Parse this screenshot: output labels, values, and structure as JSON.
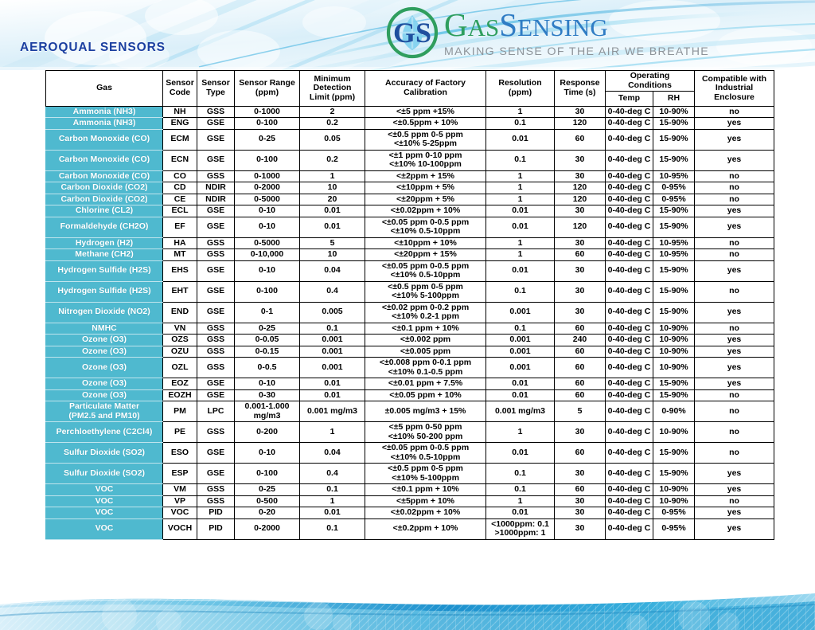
{
  "header": {
    "left_title": "AEROQUAL SENSORS",
    "logo": {
      "mark_name": "gs-monogram-logo",
      "word_1": "G",
      "word_2": "AS",
      "word_3": "S",
      "word_4": "ENSING",
      "tagline": "MAKING SENSE OF THE AIR WE BREATHE",
      "green": "#2f9e5e",
      "blue": "#2f7cc4",
      "tagline_color": "#8d9399"
    }
  },
  "colors": {
    "header_navy": "#1d3763",
    "gas_teal": "#4fb9cf",
    "title_blue": "#1b3fa0",
    "banner_blue": "#27a6d9"
  },
  "table": {
    "columns": [
      "Gas",
      "Sensor Code",
      "Sensor Type",
      "Sensor Range (ppm)",
      "Minimum Detection Limit (ppm)",
      "Accuracy of Factory Calibration",
      "Resolution (ppm)",
      "Response Time (s)",
      "Operating Conditions",
      "Compatible with Industrial Enclosure"
    ],
    "headers": {
      "gas": "Gas",
      "sensor_code_l1": "Sensor",
      "sensor_code_l2": "Code",
      "sensor_type_l1": "Sensor",
      "sensor_type_l2": "Type",
      "sensor_range_l1": "Sensor Range",
      "sensor_range_l2": "(ppm)",
      "min_det_l1": "Minimum",
      "min_det_l2": "Detection",
      "min_det_l3": "Limit (ppm)",
      "accuracy_l1": "Accuracy of Factory",
      "accuracy_l2": "Calibration",
      "resolution_l1": "Resolution",
      "resolution_l2": "(ppm)",
      "response_l1": "Response",
      "response_l2": "Time (s)",
      "operating_conditions": "Operating Conditions",
      "temp": "Temp",
      "rh": "RH",
      "compat_l1": "Compatible with",
      "compat_l2": "Industrial",
      "compat_l3": "Enclosure"
    },
    "rows": [
      {
        "gas": "Ammonia (NH3)",
        "code": "NH",
        "type": "GSS",
        "range": "0-1000",
        "mdl": "2",
        "accuracy": "<±5 ppm +15%",
        "resolution": "1",
        "response": "30",
        "temp": "0-40-deg C",
        "rh": "10-90%",
        "compat": "no"
      },
      {
        "gas": "Ammonia (NH3)",
        "code": "ENG",
        "type": "GSE",
        "range": "0-100",
        "mdl": "0.2",
        "accuracy": "<±0.5ppm + 10%",
        "resolution": "0.1",
        "response": "120",
        "temp": "0-40-deg C",
        "rh": "15-90%",
        "compat": "yes"
      },
      {
        "gas": "Carbon Monoxide (CO)",
        "code": "ECM",
        "type": "GSE",
        "range": "0-25",
        "mdl": "0.05",
        "accuracy": "<±0.5 ppm 0-5 ppm\n<±10% 5-25ppm",
        "resolution": "0.01",
        "response": "60",
        "temp": "0-40-deg C",
        "rh": "15-90%",
        "compat": "yes"
      },
      {
        "gas": "Carbon Monoxide (CO)",
        "code": "ECN",
        "type": "GSE",
        "range": "0-100",
        "mdl": "0.2",
        "accuracy": "<±1 ppm 0-10 ppm\n<±10% 10-100ppm",
        "resolution": "0.1",
        "response": "30",
        "temp": "0-40-deg C",
        "rh": "15-90%",
        "compat": "yes"
      },
      {
        "gas": "Carbon Monoxide (CO)",
        "code": "CO",
        "type": "GSS",
        "range": "0-1000",
        "mdl": "1",
        "accuracy": "<±2ppm + 15%",
        "resolution": "1",
        "response": "30",
        "temp": "0-40-deg C",
        "rh": "10-95%",
        "compat": "no"
      },
      {
        "gas": "Carbon Dioxide (CO2)",
        "code": "CD",
        "type": "NDIR",
        "range": "0-2000",
        "mdl": "10",
        "accuracy": "<±10ppm + 5%",
        "resolution": "1",
        "response": "120",
        "temp": "0-40-deg C",
        "rh": "0-95%",
        "compat": "no"
      },
      {
        "gas": "Carbon Dioxide (CO2)",
        "code": "CE",
        "type": "NDIR",
        "range": "0-5000",
        "mdl": "20",
        "accuracy": "<±20ppm + 5%",
        "resolution": "1",
        "response": "120",
        "temp": "0-40-deg C",
        "rh": "0-95%",
        "compat": "no"
      },
      {
        "gas": "Chlorine (CL2)",
        "code": "ECL",
        "type": "GSE",
        "range": "0-10",
        "mdl": "0.01",
        "accuracy": "<±0.02ppm + 10%",
        "resolution": "0.01",
        "response": "30",
        "temp": "0-40-deg C",
        "rh": "15-90%",
        "compat": "yes"
      },
      {
        "gas": "Formaldehyde (CH2O)",
        "code": "EF",
        "type": "GSE",
        "range": "0-10",
        "mdl": "0.01",
        "accuracy": "<±0.05 ppm 0-0.5 ppm\n<±10% 0.5-10ppm",
        "resolution": "0.01",
        "response": "120",
        "temp": "0-40-deg C",
        "rh": "15-90%",
        "compat": "yes"
      },
      {
        "gas": "Hydrogen (H2)",
        "code": "HA",
        "type": "GSS",
        "range": "0-5000",
        "mdl": "5",
        "accuracy": "<±10ppm + 10%",
        "resolution": "1",
        "response": "30",
        "temp": "0-40-deg C",
        "rh": "10-95%",
        "compat": "no"
      },
      {
        "gas": "Methane (CH2)",
        "code": "MT",
        "type": "GSS",
        "range": "0-10,000",
        "mdl": "10",
        "accuracy": "<±20ppm + 15%",
        "resolution": "1",
        "response": "60",
        "temp": "0-40-deg C",
        "rh": "10-95%",
        "compat": "no"
      },
      {
        "gas": "Hydrogen Sulfide (H2S)",
        "code": "EHS",
        "type": "GSE",
        "range": "0-10",
        "mdl": "0.04",
        "accuracy": "<±0.05 ppm 0-0.5 ppm\n<±10% 0.5-10ppm",
        "resolution": "0.01",
        "response": "30",
        "temp": "0-40-deg C",
        "rh": "15-90%",
        "compat": "yes"
      },
      {
        "gas": "Hydrogen Sulfide (H2S)",
        "code": "EHT",
        "type": "GSE",
        "range": "0-100",
        "mdl": "0.4",
        "accuracy": "<±0.5 ppm 0-5 ppm\n<±10% 5-100ppm",
        "resolution": "0.1",
        "response": "30",
        "temp": "0-40-deg C",
        "rh": "15-90%",
        "compat": "no"
      },
      {
        "gas": "Nitrogen Dioxide (NO2)",
        "code": "END",
        "type": "GSE",
        "range": "0-1",
        "mdl": "0.005",
        "accuracy": "<±0.02 ppm 0-0.2 ppm\n<±10% 0.2-1 ppm",
        "resolution": "0.001",
        "response": "30",
        "temp": "0-40-deg C",
        "rh": "15-90%",
        "compat": "yes"
      },
      {
        "gas": "NMHC",
        "code": "VN",
        "type": "GSS",
        "range": "0-25",
        "mdl": "0.1",
        "accuracy": "<±0.1 ppm + 10%",
        "resolution": "0.1",
        "response": "60",
        "temp": "0-40-deg C",
        "rh": "10-90%",
        "compat": "no"
      },
      {
        "gas": "Ozone (O3)",
        "code": "OZS",
        "type": "GSS",
        "range": "0-0.05",
        "mdl": "0.001",
        "accuracy": "<±0.002 ppm",
        "resolution": "0.001",
        "response": "240",
        "temp": "0-40-deg C",
        "rh": "10-90%",
        "compat": "yes"
      },
      {
        "gas": "Ozone (O3)",
        "code": "OZU",
        "type": "GSS",
        "range": "0-0.15",
        "mdl": "0.001",
        "accuracy": "<±0.005 ppm",
        "resolution": "0.001",
        "response": "60",
        "temp": "0-40-deg C",
        "rh": "10-90%",
        "compat": "yes"
      },
      {
        "gas": "Ozone (O3)",
        "code": "OZL",
        "type": "GSS",
        "range": "0-0.5",
        "mdl": "0.001",
        "accuracy": "<±0.008 ppm 0-0.1 ppm\n<±10% 0.1-0.5 ppm",
        "resolution": "0.001",
        "response": "60",
        "temp": "0-40-deg C",
        "rh": "10-90%",
        "compat": "yes"
      },
      {
        "gas": "Ozone (O3)",
        "code": "EOZ",
        "type": "GSE",
        "range": "0-10",
        "mdl": "0.01",
        "accuracy": "<±0.01 ppm + 7.5%",
        "resolution": "0.01",
        "response": "60",
        "temp": "0-40-deg C",
        "rh": "15-90%",
        "compat": "yes"
      },
      {
        "gas": "Ozone (O3)",
        "code": "EOZH",
        "type": "GSE",
        "range": "0-30",
        "mdl": "0.01",
        "accuracy": "<±0.05 ppm + 10%",
        "resolution": "0.01",
        "response": "60",
        "temp": "0-40-deg C",
        "rh": "15-90%",
        "compat": "no"
      },
      {
        "gas": "Particulate Matter\n(PM2.5 and PM10)",
        "code": "PM",
        "type": "LPC",
        "range": "0.001-1.000\nmg/m3",
        "mdl": "0.001 mg/m3",
        "accuracy": "±0.005 mg/m3 + 15%",
        "resolution": "0.001 mg/m3",
        "response": "5",
        "temp": "0-40-deg C",
        "rh": "0-90%",
        "compat": "no"
      },
      {
        "gas": "Perchloethylene (C2Cl4)",
        "code": "PE",
        "type": "GSS",
        "range": "0-200",
        "mdl": "1",
        "accuracy": "<±5 ppm 0-50 ppm\n<±10% 50-200 ppm",
        "resolution": "1",
        "response": "30",
        "temp": "0-40-deg C",
        "rh": "10-90%",
        "compat": "no"
      },
      {
        "gas": "Sulfur Dioxide (SO2)",
        "code": "ESO",
        "type": "GSE",
        "range": "0-10",
        "mdl": "0.04",
        "accuracy": "<±0.05 ppm 0-0.5 ppm\n<±10% 0.5-10ppm",
        "resolution": "0.01",
        "response": "60",
        "temp": "0-40-deg C",
        "rh": "15-90%",
        "compat": "no"
      },
      {
        "gas": "Sulfur Dioxide (SO2)",
        "code": "ESP",
        "type": "GSE",
        "range": "0-100",
        "mdl": "0.4",
        "accuracy": "<±0.5 ppm 0-5 ppm\n<±10% 5-100ppm",
        "resolution": "0.1",
        "response": "30",
        "temp": "0-40-deg C",
        "rh": "15-90%",
        "compat": "yes"
      },
      {
        "gas": "VOC",
        "code": "VM",
        "type": "GSS",
        "range": "0-25",
        "mdl": "0.1",
        "accuracy": "<±0.1 ppm + 10%",
        "resolution": "0.1",
        "response": "60",
        "temp": "0-40-deg C",
        "rh": "10-90%",
        "compat": "yes"
      },
      {
        "gas": "VOC",
        "code": "VP",
        "type": "GSS",
        "range": "0-500",
        "mdl": "1",
        "accuracy": "<±5ppm + 10%",
        "resolution": "1",
        "response": "30",
        "temp": "0-40-deg C",
        "rh": "10-90%",
        "compat": "no"
      },
      {
        "gas": "VOC",
        "code": "VOC",
        "type": "PID",
        "range": "0-20",
        "mdl": "0.01",
        "accuracy": "<±0.02ppm + 10%",
        "resolution": "0.01",
        "response": "30",
        "temp": "0-40-deg C",
        "rh": "0-95%",
        "compat": "yes"
      },
      {
        "gas": "VOC",
        "code": "VOCH",
        "type": "PID",
        "range": "0-2000",
        "mdl": "0.1",
        "accuracy": "<±0.2ppm + 10%",
        "resolution": "<1000ppm: 0.1\n>1000ppm: 1",
        "response": "30",
        "temp": "0-40-deg C",
        "rh": "0-95%",
        "compat": "yes"
      }
    ]
  }
}
